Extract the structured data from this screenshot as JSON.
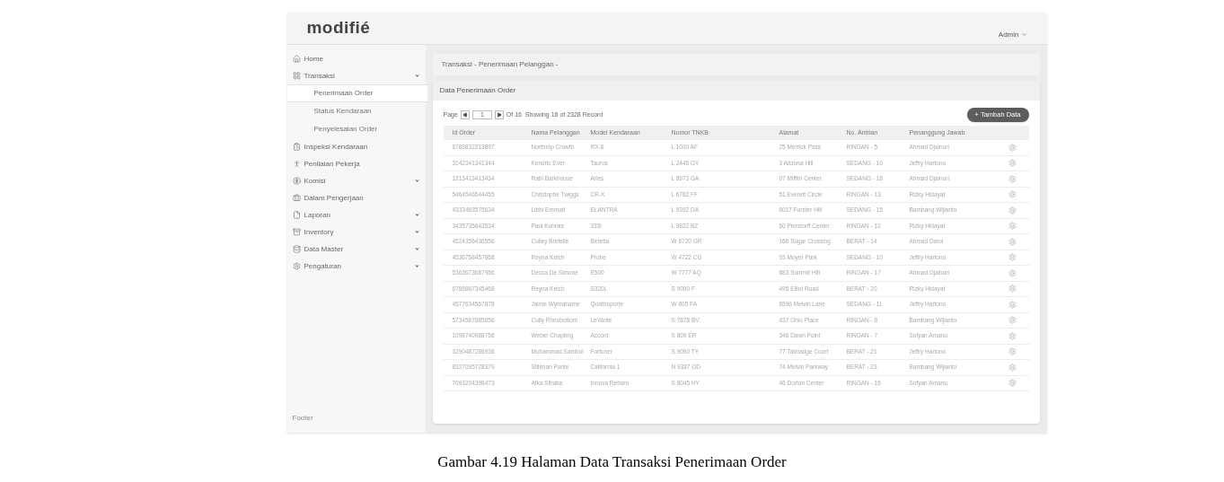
{
  "header": {
    "logo": "modifié",
    "user": "Admin"
  },
  "sidebar": {
    "items": [
      {
        "label": "Home",
        "kind": "link"
      },
      {
        "label": "Transaksi",
        "kind": "group",
        "children": [
          {
            "label": "Penerimaan Order",
            "selected": true
          },
          {
            "label": "Status Kendaraan",
            "selected": false
          },
          {
            "label": "Penyelesaian Order",
            "selected": false
          }
        ]
      },
      {
        "label": "Inspeksi Kendaraan",
        "kind": "link"
      },
      {
        "label": "Penilaian Pekerja",
        "kind": "link"
      },
      {
        "label": "Komisi",
        "kind": "group"
      },
      {
        "label": "Dalam Pengerjaan",
        "kind": "link"
      },
      {
        "label": "Laporan",
        "kind": "group"
      },
      {
        "label": "Inventory",
        "kind": "group"
      },
      {
        "label": "Data Master",
        "kind": "group"
      },
      {
        "label": "Pengaturan",
        "kind": "group"
      }
    ],
    "footer": "Footer"
  },
  "breadcrumb": "Transaksi - Penerimaan Pelanggan -",
  "card": {
    "title": "Data Penerimaan Order",
    "pager": {
      "label": "Page",
      "value": "1",
      "summary": "Of 16  Showing 16 of 2328 Record"
    },
    "add_button": "+ Tambah Data"
  },
  "table": {
    "columns": [
      "Id Order",
      "Nama Pelanggan",
      "Model Kendaraan",
      "Nomor TNKB",
      "Alamat",
      "No. Antrian",
      "Penanggung Jawab"
    ],
    "rows": [
      [
        "8769832213897",
        "Northrop Crowth",
        "RX-8",
        "L 1000 AF",
        "25 Merrick Pass",
        "RINGAN - 5",
        "Ahmad Djainuri"
      ],
      [
        "3142341341344",
        "Kendric Ever",
        "Taurus",
        "L 2445 GY",
        "3 Arizona Hill",
        "SEDANG - 10",
        "Jeffry Hartono"
      ],
      [
        "1213413413434",
        "Rabi Barkhouse",
        "Aries",
        "L 8973 GA",
        "07 Mifflin Center",
        "SEDANG - 18",
        "Ahmad Djainuri"
      ],
      [
        "5464546544455",
        "Christophe Twiggs",
        "CR-X",
        "L 6782 FF",
        "51 Everett Circle",
        "RINGAN - 13",
        "Rizky Hidayat"
      ],
      [
        "4333463575634",
        "Libbi Emmatt",
        "ELANTRA",
        "L 9392 DA",
        "6017 Forster Hill",
        "SEDANG - 15",
        "Bambang Wijianto"
      ],
      [
        "3435735642534",
        "Paul Kuhnke",
        "335i",
        "L 9822 BZ",
        "60 Pierstorff Center",
        "RINGAN - 12",
        "Rizky Hidayat"
      ],
      [
        "4524356436556",
        "Culley Bretelle",
        "Beretta",
        "W 6720 GR",
        "166 Sugar Crossing",
        "BERAT - 14",
        "Ahmad Darul"
      ],
      [
        "4536758457868",
        "Reyna Ketch",
        "Probe",
        "W 4722 CG",
        "93 Moyer Park",
        "SEDANG - 10",
        "Jeffry Hartono"
      ],
      [
        "5363673687956",
        "Decca De Simone",
        "E500",
        "W 7777 AQ",
        "683 Summit Hill",
        "RINGAN - 17",
        "Ahmad Djainuri"
      ],
      [
        "6786867345468",
        "Reyna Ketch",
        "S320L",
        "S 9090 F",
        "495 Elliot Road",
        "BERAT - 20",
        "Rizky Hidayat"
      ],
      [
        "4577634567878",
        "Jaime Wynrahame",
        "Quattroporte",
        "W 805 FA",
        "6596 Melvin Lane",
        "SEDANG - 11",
        "Jeffry Hartono"
      ],
      [
        "5734567685656",
        "Cully Rheubottom",
        "LeVante",
        "S 7878 BV",
        "437 Ohio Place",
        "RINGAN - 8",
        "Bambang Wijianto"
      ],
      [
        "1098740988758",
        "Weber Chapling",
        "Accord",
        "S 809 ER",
        "346 Dawn Point",
        "RINGAN - 7",
        "Sofyan Amanu"
      ],
      [
        "3290487286936",
        "Muhammad Sambul",
        "Fortuner",
        "S 9090 TY",
        "77 Talmadge Court",
        "BERAT - 21",
        "Jeffry Hartono"
      ],
      [
        "8327095728379",
        "Stillman Ponte",
        "California 1",
        "N 9387 OD",
        "74 Melvin Parkway",
        "BERAT - 23",
        "Bambang Wijianto"
      ],
      [
        "7093204398473",
        "Afka Sibaka",
        "Innova Reborn",
        "S 8045 HY",
        "46 Dorton Center",
        "RINGAN - 16",
        "Sofyan Amanu"
      ]
    ]
  },
  "caption": "Gambar 4.19 Halaman Data Transaksi Penerimaan Order"
}
